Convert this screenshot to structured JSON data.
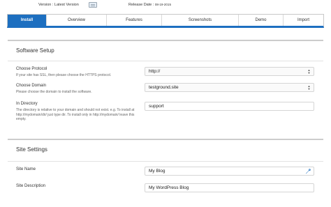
{
  "top": {
    "version_label": "Version : Latest Version",
    "release_label": "Release Date :",
    "release_date": "08-19-2015"
  },
  "tabs": [
    {
      "label": "Install",
      "active": true
    },
    {
      "label": "Overview",
      "active": false
    },
    {
      "label": "Features",
      "active": false
    },
    {
      "label": "Screenshots",
      "active": false
    },
    {
      "label": "Demo",
      "active": false
    },
    {
      "label": "Import",
      "active": false
    }
  ],
  "software_setup": {
    "title": "Software Setup",
    "protocol_label": "Choose Protocol",
    "protocol_hint": "If your site has SSL, then please choose the HTTPS protocol.",
    "protocol_value": "http://",
    "domain_label": "Choose Domain",
    "domain_hint": "Please choose the domain to install the software.",
    "domain_value": "testground.site",
    "directory_label": "In Directory",
    "directory_hint": "The directory is relative to your domain and should not exist. e.g. To install at http://mydomain/dir/ just type dir. To install only in http://mydomain/ leave this empty.",
    "directory_value": "support"
  },
  "site_settings": {
    "title": "Site Settings",
    "name_label": "Site Name",
    "name_value": "My Blog",
    "desc_label": "Site Description",
    "desc_value": "My WordPress Blog"
  },
  "colors": {
    "accent": "#1d6fc0",
    "wrench": "#1d6fc0"
  }
}
